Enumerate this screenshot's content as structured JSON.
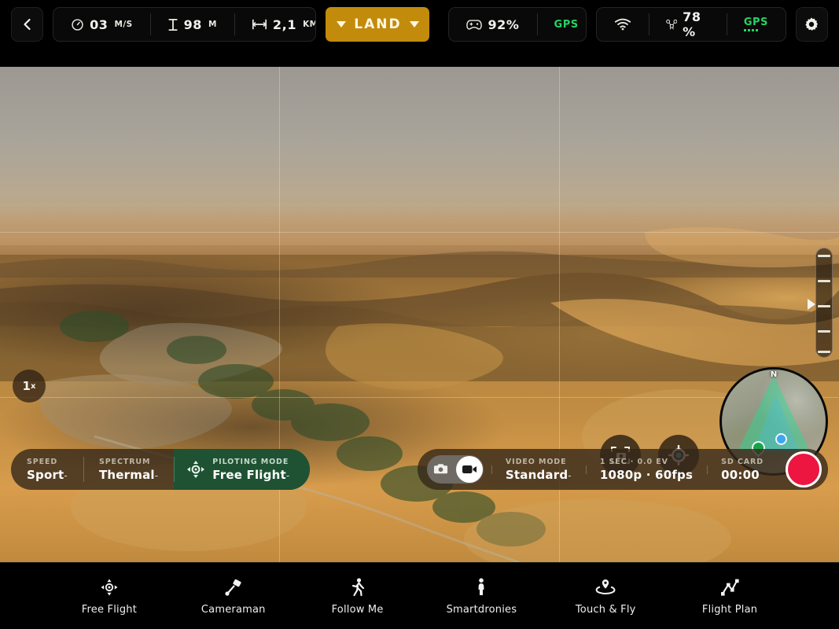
{
  "topbar": {
    "back_label": "back",
    "telemetry": [
      {
        "icon": "speedometer-icon",
        "value": "03",
        "unit": "M/S",
        "name": "speed-readout"
      },
      {
        "icon": "altitude-icon",
        "value": "98",
        "unit": "M",
        "name": "altitude-readout"
      },
      {
        "icon": "distance-icon",
        "value": "2,1",
        "unit": "KM",
        "name": "distance-readout"
      }
    ],
    "land_button": {
      "label": "LAND",
      "color": "#c28b0c"
    },
    "controller": {
      "icon": "controller-icon",
      "battery": "92%",
      "gps": "GPS",
      "gps_color": "#25d366"
    },
    "drone": {
      "wifi_icon": "wifi-icon",
      "drone_icon": "drone-icon",
      "battery": "78 %",
      "gps": "GPS",
      "gps_color": "#25d366"
    },
    "settings_label": "settings"
  },
  "feed": {
    "zoom_badge": "1",
    "zoom_suffix": "x",
    "slider_name": "exposure-slider",
    "reframe_button": "reframe-button",
    "recenter_button": "recenter-button",
    "minimap": {
      "north_label": "N",
      "home_marker": "home-marker",
      "drone_marker": "drone-marker"
    }
  },
  "left_panel": {
    "speed": {
      "caption": "SPEED",
      "value": "Sport",
      "chevron": "-"
    },
    "spectrum": {
      "caption": "SPECTRUM",
      "value": "Thermal",
      "chevron": "-"
    },
    "piloting_mode": {
      "caption": "PILOTING MODE",
      "value": "Free Flight",
      "chevron": "-",
      "color": "#1e5233"
    }
  },
  "right_panel": {
    "toggle": {
      "photo_icon": "photo-camera-icon",
      "video_icon": "video-camera-icon",
      "active": "video"
    },
    "video_mode": {
      "caption": "VIDEO MODE",
      "value": "Standard",
      "chevron": "-"
    },
    "exposure": {
      "caption": "1 sec · 0.0 EV",
      "value": "1080p · 60fps"
    },
    "sd_card": {
      "caption": "SD CARD",
      "value": "00:00"
    },
    "record_button": {
      "label": "record",
      "color": "#ec1640"
    }
  },
  "bottom_nav": [
    {
      "label": "Free Flight",
      "icon": "dpad-icon"
    },
    {
      "label": "Cameraman",
      "icon": "cameraman-icon"
    },
    {
      "label": "Follow Me",
      "icon": "running-person-icon"
    },
    {
      "label": "Smartdronies",
      "icon": "standing-person-icon"
    },
    {
      "label": "Touch & Fly",
      "icon": "map-pin-icon"
    },
    {
      "label": "Flight Plan",
      "icon": "waypoints-icon"
    }
  ]
}
